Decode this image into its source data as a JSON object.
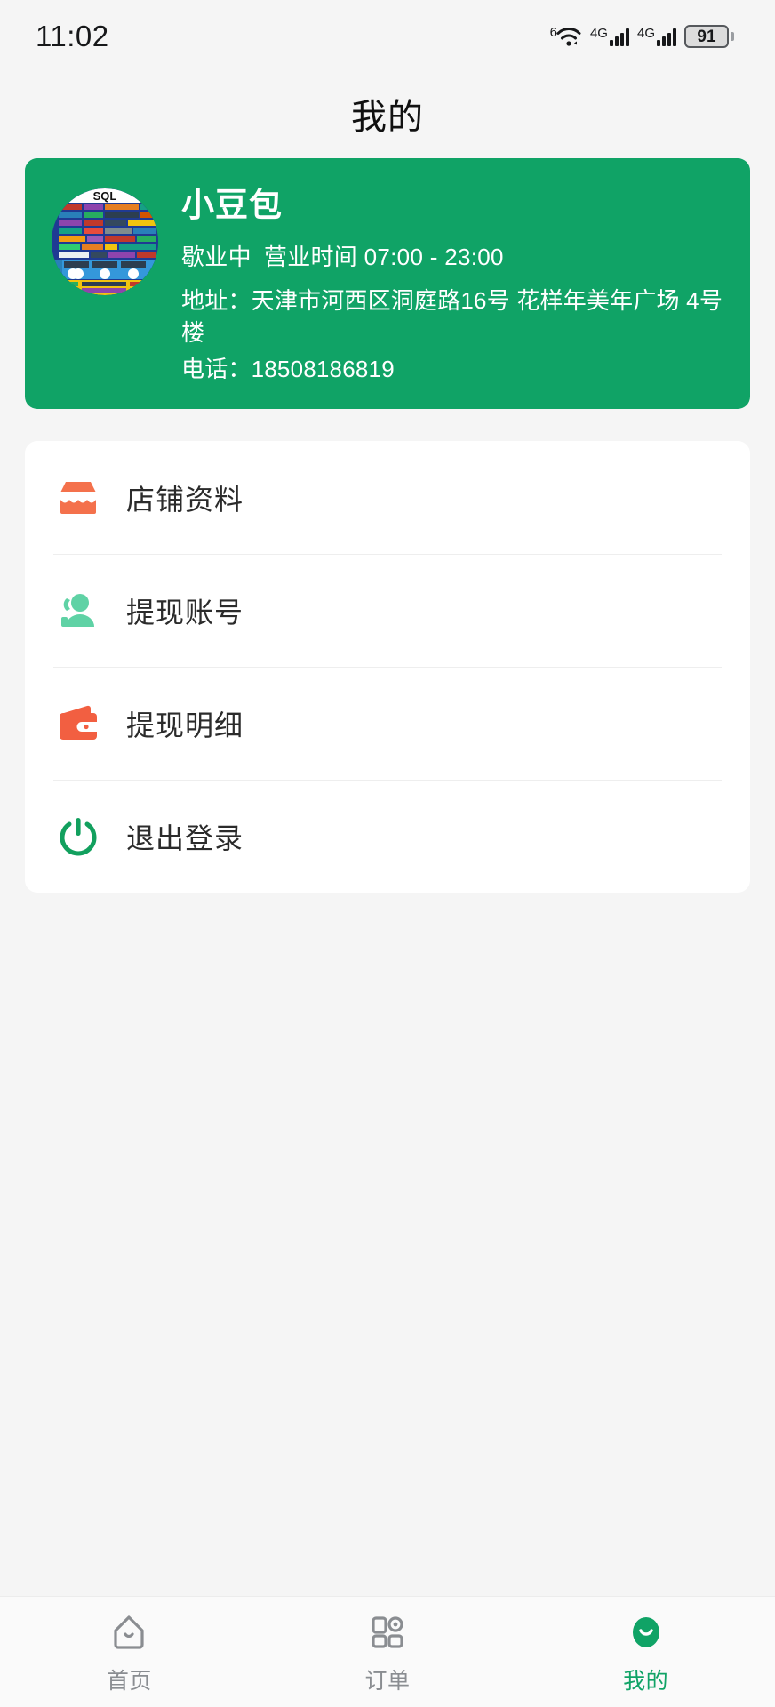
{
  "statusbar": {
    "time": "11:02",
    "wifi_sup": "6",
    "wifi_plus": "+",
    "net1_label": "4G",
    "net2_label": "4G",
    "battery_percent": "91",
    "icons": [
      "wifi-6-plus-icon",
      "signal-4g-icon",
      "signal-4g-icon",
      "battery-icon"
    ]
  },
  "header": {
    "title": "我的"
  },
  "profile": {
    "avatar_alt": "sql-cheatsheet-avatar",
    "avatar_title": "SQL",
    "shop_name": "小豆包",
    "status": "歇业中",
    "hours_label": "营业时间",
    "hours_value": "07:00 - 23:00",
    "address": "地址：天津市河西区洞庭路16号 花样年美年广场 4号楼",
    "phone": "电话：18508186819",
    "card_color": "#10a366"
  },
  "menu": {
    "items": [
      {
        "label": "店铺资料",
        "icon": "shop-icon",
        "color": "#f4714c"
      },
      {
        "label": "提现账号",
        "icon": "person-icon",
        "color": "#5fd2a5"
      },
      {
        "label": "提现明细",
        "icon": "wallet-icon",
        "color": "#f25f41"
      },
      {
        "label": "退出登录",
        "icon": "power-icon",
        "color": "#12a05e"
      }
    ]
  },
  "tabbar": {
    "items": [
      {
        "label": "首页",
        "icon": "home-icon",
        "active": false
      },
      {
        "label": "订单",
        "icon": "orders-icon",
        "active": false
      },
      {
        "label": "我的",
        "icon": "profile-icon",
        "active": true
      }
    ],
    "active_color": "#10a366",
    "inactive_color": "#8a8d91"
  }
}
